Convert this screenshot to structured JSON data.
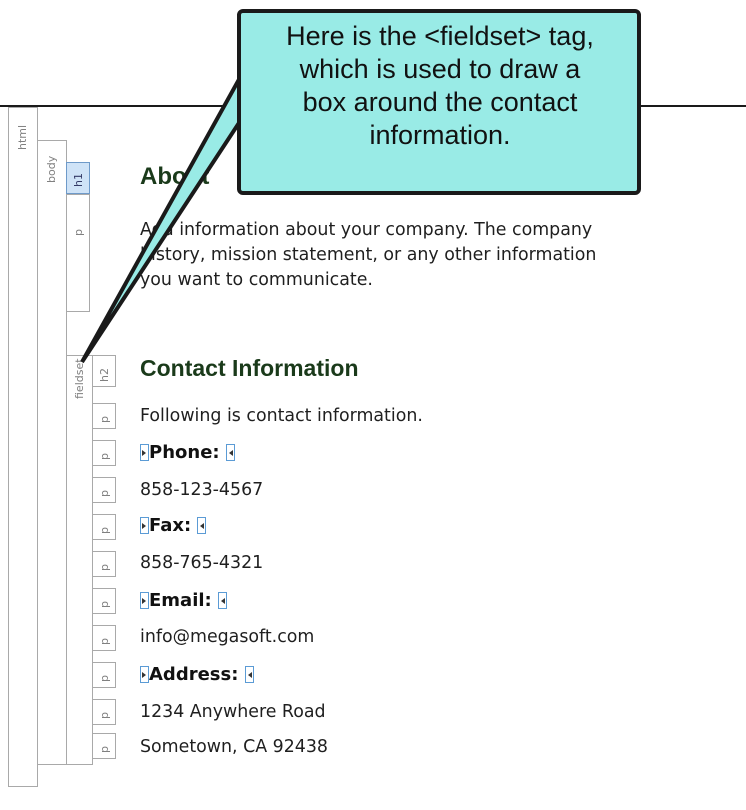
{
  "structure_bar": {
    "html_label": "html",
    "body_label": "body",
    "h1_label": "h1",
    "p_label": "p",
    "fieldset_label": "fieldset",
    "h2_label": "h2"
  },
  "document": {
    "heading": "About",
    "intro_lines": [
      "Add information about your company. The company",
      "history, mission statement, or any other information",
      "you want to communicate."
    ],
    "contact_heading": "Contact Information",
    "following": "Following is contact information.",
    "phone_label": "Phone:",
    "phone_value": "858-123-4567",
    "fax_label": "Fax:",
    "fax_value": "858-765-4321",
    "email_label": "Email:",
    "email_value": "info@megasoft.com",
    "address_label": "Address:",
    "address_line1": "1234 Anywhere Road",
    "address_line2": "Sometown, CA 92438"
  },
  "callout": {
    "lines": [
      "Here is the <fieldset> tag,",
      "which is used to draw a",
      "box around the contact",
      "information."
    ]
  },
  "colors": {
    "callout_fill": "#99ebe6",
    "selected_tag": "#cfe3f7",
    "heading": "#1a3a1a",
    "marker": "#5b9bd5"
  }
}
